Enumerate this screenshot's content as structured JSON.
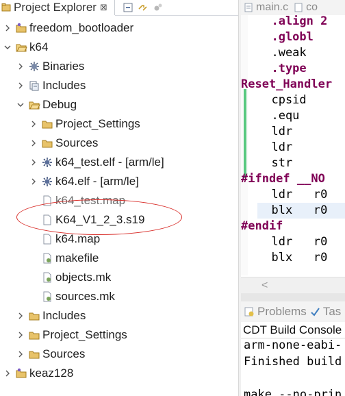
{
  "explorer": {
    "tab_title": "Project Explorer",
    "tab_close": "⊠",
    "tree": [
      {
        "label": "freedom_bootloader",
        "icon": "project-folder-icon",
        "expander": "collapsed",
        "muted": false
      },
      {
        "label": "k64",
        "icon": "project-folder-open-icon",
        "expander": "expanded",
        "muted": false
      },
      {
        "label": "Binaries",
        "icon": "binaries-icon",
        "expander": "collapsed",
        "muted": false
      },
      {
        "label": "Includes",
        "icon": "includes-icon",
        "expander": "collapsed",
        "muted": false
      },
      {
        "label": "Debug",
        "icon": "folder-open-icon",
        "expander": "expanded",
        "muted": false
      },
      {
        "label": "Project_Settings",
        "icon": "folder-icon",
        "expander": "collapsed",
        "muted": false
      },
      {
        "label": "Sources",
        "icon": "folder-icon",
        "expander": "collapsed",
        "muted": false
      },
      {
        "label": "k64_test.elf - [arm/le]",
        "icon": "elf-binary-icon",
        "expander": "collapsed",
        "muted": false
      },
      {
        "label": "k64.elf - [arm/le]",
        "icon": "elf-binary-icon",
        "expander": "collapsed",
        "muted": false
      },
      {
        "label": "k64_test.map",
        "icon": "file-icon",
        "expander": "none",
        "muted": true
      },
      {
        "label": "K64_V1_2_3.s19",
        "icon": "file-icon",
        "expander": "none",
        "muted": false
      },
      {
        "label": "k64.map",
        "icon": "file-icon",
        "expander": "none",
        "muted": false
      },
      {
        "label": "makefile",
        "icon": "makefile-icon",
        "expander": "none",
        "muted": false
      },
      {
        "label": "objects.mk",
        "icon": "makefile-icon",
        "expander": "none",
        "muted": false
      },
      {
        "label": "sources.mk",
        "icon": "makefile-icon",
        "expander": "none",
        "muted": false
      },
      {
        "label": "Includes",
        "icon": "folder-icon",
        "expander": "collapsed",
        "muted": false
      },
      {
        "label": "Project_Settings",
        "icon": "folder-icon",
        "expander": "collapsed",
        "muted": false
      },
      {
        "label": "Sources",
        "icon": "folder-icon",
        "expander": "collapsed",
        "muted": false
      },
      {
        "label": "keaz128",
        "icon": "project-folder-icon",
        "expander": "collapsed",
        "muted": false
      }
    ]
  },
  "editor": {
    "tabs": [
      "main.c",
      "co"
    ],
    "code_lines": [
      {
        "text": "  .align 2",
        "kind": "kw"
      },
      {
        "text": "  .globl",
        "kind": "kw"
      },
      {
        "text": "  .weak",
        "kind": "dir"
      },
      {
        "text": "  .type",
        "kind": "kw"
      },
      {
        "text": "Reset_Handler",
        "kind": "kw"
      },
      {
        "text": "  cpsid",
        "kind": "dir"
      },
      {
        "text": "  .equ",
        "kind": "dir"
      },
      {
        "text": "  ldr",
        "kind": "dir"
      },
      {
        "text": "  ldr",
        "kind": "dir"
      },
      {
        "text": "  str",
        "kind": "dir"
      },
      {
        "text": "#ifndef __NO",
        "kind": "kw"
      },
      {
        "text": "  ldr   r0",
        "kind": "dir"
      },
      {
        "text": "  blx   r0",
        "kind": "dir"
      },
      {
        "text": "#endif",
        "kind": "kw"
      },
      {
        "text": "  ldr   r0",
        "kind": "dir"
      },
      {
        "text": "  blx   r0",
        "kind": "dir"
      }
    ],
    "highlighted_line": 12,
    "scroll_left_arrow": "<"
  },
  "console": {
    "tabs": [
      "Problems",
      "Tas"
    ],
    "title": "CDT Build Console",
    "output": [
      "arm-none-eabi-",
      "Finished build",
      "",
      "make --no-prin"
    ]
  },
  "colors": {
    "keyword": "#7f0055",
    "highlight_ellipse": "#d9302c",
    "ruler_mark": "#3cbf6a"
  }
}
